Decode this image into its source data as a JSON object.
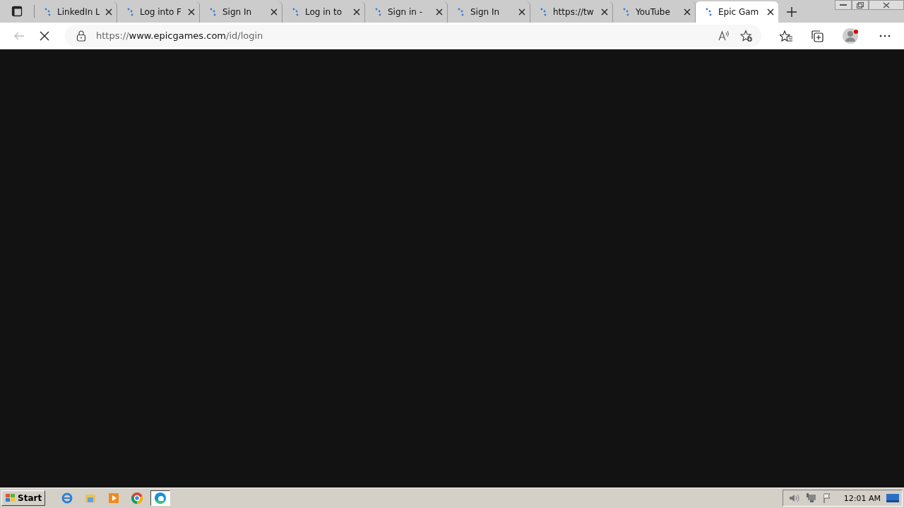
{
  "tabs": [
    {
      "title": "LinkedIn L",
      "selected": false
    },
    {
      "title": "Log into F",
      "selected": false
    },
    {
      "title": "Sign In",
      "selected": false
    },
    {
      "title": "Log in to",
      "selected": false
    },
    {
      "title": "Sign in -",
      "selected": false
    },
    {
      "title": "Sign In",
      "selected": false
    },
    {
      "title": "https://tw",
      "selected": false
    },
    {
      "title": "YouTube",
      "selected": false
    },
    {
      "title": "Epic Gam",
      "selected": true
    }
  ],
  "address_bar": {
    "scheme": "https://",
    "host": "www.epicgames.com",
    "path": "/id/login"
  },
  "taskbar": {
    "start": "Start",
    "apps": [
      {
        "kind": "ie",
        "selected": false
      },
      {
        "kind": "folder",
        "selected": false
      },
      {
        "kind": "media",
        "selected": false
      },
      {
        "kind": "chrome",
        "selected": false
      },
      {
        "kind": "edge",
        "selected": true
      }
    ],
    "clock": "12:01 AM"
  }
}
